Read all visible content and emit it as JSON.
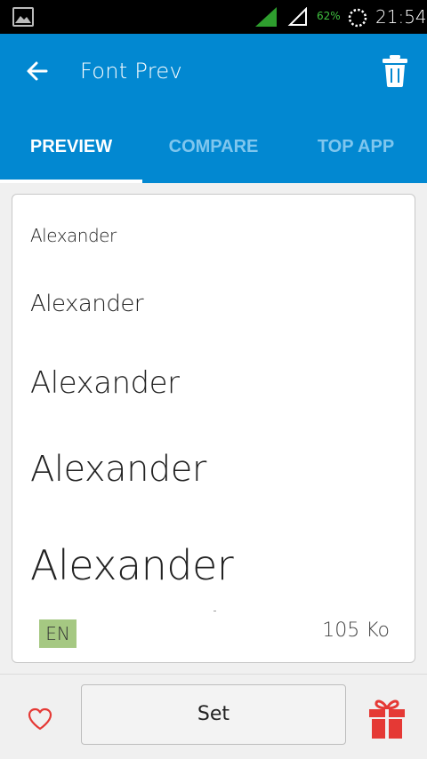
{
  "status_bar": {
    "battery": "62%",
    "time": "21:54",
    "icons": [
      "gallery-icon",
      "signal-icon",
      "signal-empty-icon",
      "loading-circle-icon"
    ]
  },
  "app_bar": {
    "title": "Font Prev",
    "back_icon": "arrow-back-icon",
    "delete_icon": "trash-icon"
  },
  "tabs": [
    {
      "label": "PREVIEW",
      "active": true
    },
    {
      "label": "COMPARE",
      "active": false
    },
    {
      "label": "TOP APP",
      "active": false
    }
  ],
  "preview": {
    "samples": [
      "Alexander",
      "Alexander",
      "Alexander",
      "Alexander",
      "Alexander"
    ],
    "language": "EN",
    "file_size": "105 Ko"
  },
  "bottom_bar": {
    "favorite_icon": "heart-icon",
    "set_label": "Set",
    "gift_icon": "gift-icon"
  },
  "colors": {
    "primary": "#0288d1",
    "tab_inactive": "#7fc6ee",
    "badge": "#a5c882",
    "accent_red": "#e53935"
  }
}
